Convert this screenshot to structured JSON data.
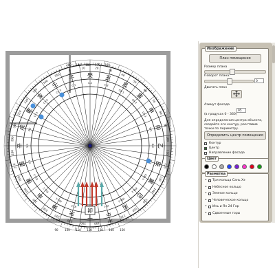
{
  "compass": {
    "outer_degrees": [
      "330",
      "340",
      "350",
      "0",
      "10",
      "20",
      "30",
      "40",
      "50",
      "60",
      "70",
      "80",
      "90",
      "100",
      "110",
      "120",
      "130",
      "140",
      "150",
      "160",
      "170",
      "180",
      "190",
      "200",
      "210",
      "220",
      "230",
      "240",
      "250",
      "260",
      "270",
      "280",
      "290",
      "300",
      "310",
      "320"
    ],
    "mountains": [
      "子",
      "癸",
      "丑",
      "艮",
      "寅",
      "甲",
      "卯",
      "乙",
      "辰",
      "巽",
      "巳",
      "丙",
      "午",
      "丁",
      "未",
      "坤",
      "申",
      "庚",
      "酉",
      "辛",
      "戌",
      "乾",
      "亥",
      "壬"
    ],
    "sector_codes": [
      "С-1",
      "С-2",
      "С-3",
      "СВ-1",
      "СВ-2",
      "СВ-3",
      "В-1",
      "В-2",
      "В-3",
      "ЮВ-1",
      "ЮВ-2",
      "ЮВ-3",
      "Ю-1",
      "Ю-2",
      "Ю-3",
      "ЮЗ-1",
      "ЮЗ-2",
      "ЮЗ-3",
      "З-1",
      "З-2",
      "З-3",
      "СЗ-1",
      "СЗ-2",
      "СЗ-3"
    ],
    "bottom_degrees": [
      "200",
      "190",
      "180",
      "170",
      "160"
    ],
    "bottom_tick_labels": [
      "90",
      "100",
      "110",
      "120",
      "130",
      "140",
      "150"
    ],
    "highlight_marker": "卯",
    "colors": {
      "ring": "#1a1a1a",
      "arrow_red": "#c0392b",
      "arrow_teal": "#5aa9a9",
      "dots": "#4a90d9",
      "walls": "#999999"
    }
  },
  "panel": {
    "image_section": {
      "title": "Изображение",
      "floor_plan_button": "План помещения",
      "plan_size_label": "Размер плана",
      "plan_rotation_label": "Поворот плана:",
      "rotation_value": "0",
      "move_plan_label": "Двигать план",
      "facade_azimuth_label": "Азимут фасада",
      "facade_azimuth_value": "95",
      "degrees_hint": "(в градусах 0 - 360)",
      "center_hint": "Для определения центра объекта, создайте его контур, расставив точки по периметру.",
      "determine_center_button": "Определить центр помещения",
      "checkboxes": [
        {
          "label": "Контур",
          "checked": false
        },
        {
          "label": "Центр",
          "checked": true
        },
        {
          "label": "Направление фасада",
          "checked": false
        }
      ]
    },
    "color_section": {
      "title": "Цвет",
      "swatches": [
        "#000000",
        "#ffffff",
        "#aaaaaa",
        "#2244ff",
        "#7a1fd6",
        "#ff33cc",
        "#e0001a",
        "#12a012"
      ]
    },
    "markings_section": {
      "title": "Разметка",
      "items": [
        {
          "label": "Три кольца Сань Хэ",
          "checked": false
        },
        {
          "label": "Небесное кольцо",
          "checked": false
        },
        {
          "label": "Земное кольцо",
          "checked": false
        },
        {
          "label": "Человеческое кольцо",
          "checked": false
        },
        {
          "label": "Инь и Ян 24 Гор",
          "checked": false
        },
        {
          "label": "Сдвоенные горы",
          "checked": false
        }
      ]
    }
  }
}
